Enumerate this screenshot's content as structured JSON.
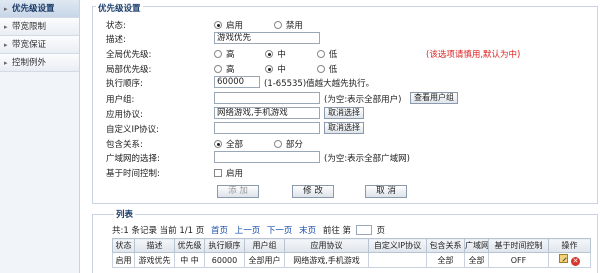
{
  "sidebar": {
    "items": [
      {
        "label": "优先级设置",
        "active": true
      },
      {
        "label": "带宽限制",
        "active": false
      },
      {
        "label": "带宽保证",
        "active": false
      },
      {
        "label": "控制例外",
        "active": false
      }
    ]
  },
  "settings": {
    "title": "优先级设置",
    "status": {
      "label": "状态:",
      "options": [
        "启用",
        "禁用"
      ],
      "selected": "启用"
    },
    "description": {
      "label": "描述:",
      "value": "游戏优先"
    },
    "global_priority": {
      "label": "全局优先级:",
      "options": [
        "高",
        "中",
        "低"
      ],
      "selected": "中",
      "note": "(该选项请慎用,默认为中)"
    },
    "local_priority": {
      "label": "局部优先级:",
      "options": [
        "高",
        "中",
        "低"
      ],
      "selected": "中"
    },
    "execution_order": {
      "label": "执行顺序:",
      "value": "60000",
      "note": "(1-65535)值越大越先执行。"
    },
    "user_group": {
      "label": "用户组:",
      "value": "",
      "note": "(为空:表示全部用户)",
      "button": "查看用户组"
    },
    "app_protocol": {
      "label": "应用协议:",
      "value": "网络游戏,手机游戏",
      "button": "取消选择"
    },
    "custom_ip_protocol": {
      "label": "自定义IP协议:",
      "value": "",
      "button": "取消选择"
    },
    "include_relation": {
      "label": "包含关系:",
      "options": [
        "全部",
        "部分"
      ],
      "selected": "全部"
    },
    "wan_selection": {
      "label": "广域网的选择:",
      "value": "",
      "note": "(为空:表示全部广域网)"
    },
    "time_control": {
      "label": "基于时间控制:",
      "checkbox_label": "启用",
      "checked": false
    },
    "buttons": {
      "add": "添 加",
      "modify": "修 改",
      "cancel": "取 消"
    }
  },
  "list": {
    "title": "列表",
    "pager": {
      "summary": "共:1 条记录 当前 1/1 页",
      "first": "首页",
      "prev": "上一页",
      "next": "下一页",
      "last": "末页",
      "goto_prefix": "前往 第",
      "goto_suffix": "页"
    },
    "columns": [
      "状态",
      "描述",
      "优先级",
      "执行顺序",
      "用户组",
      "应用协议",
      "自定义IP协议",
      "包含关系",
      "广域网",
      "基于时间控制",
      "操作"
    ],
    "rows": [
      {
        "status": "启用",
        "description": "游戏优先",
        "priority": "中 中",
        "order": "60000",
        "user_group": "全部用户",
        "app_protocol": "网络游戏,手机游戏",
        "custom_ip": "",
        "include": "全部",
        "wan": "全部",
        "time_control": "OFF"
      }
    ]
  }
}
